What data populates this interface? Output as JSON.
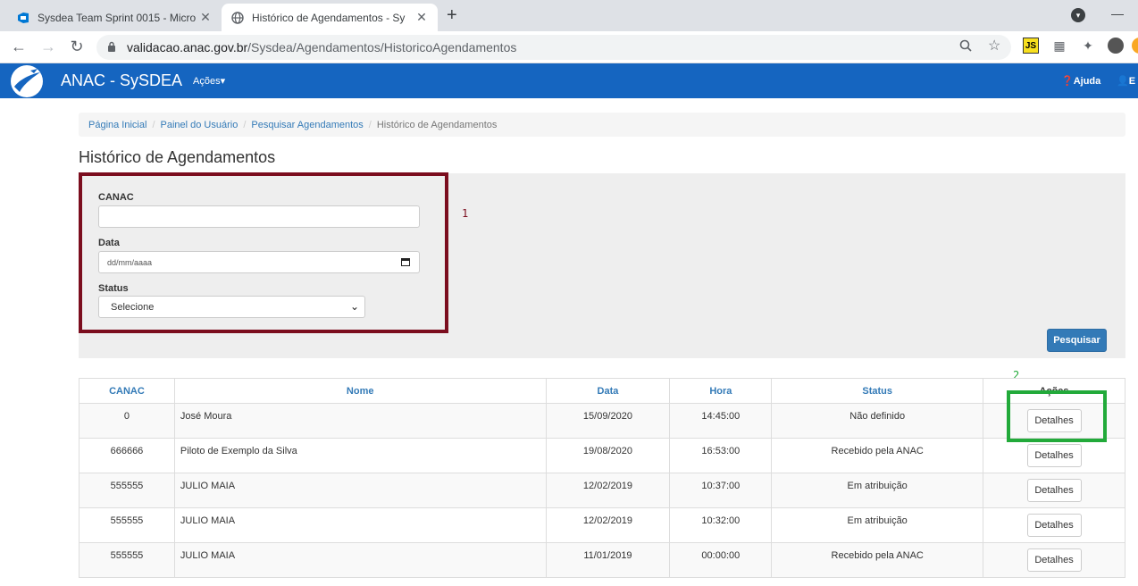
{
  "browser": {
    "tabs": [
      {
        "title": "Sysdea Team Sprint 0015 - Micro",
        "icon": "azure-devops-icon"
      },
      {
        "title": "Histórico de Agendamentos - Sy",
        "icon": "globe-icon"
      }
    ],
    "close_glyph": "✕",
    "new_tab_glyph": "+",
    "url_host": "validacao.anac.gov.br",
    "url_path": "/Sysdea/Agendamentos/HistoricoAgendamentos",
    "extensions": [
      "JS",
      "▦",
      "✦"
    ]
  },
  "navbar": {
    "brand": "ANAC - SySDEA",
    "menu_acoes": "Ações",
    "ajuda": "Ajuda",
    "user": "E",
    "accent": "#1565c0"
  },
  "breadcrumb": [
    "Página Inicial",
    "Painel do Usuário",
    "Pesquisar Agendamentos",
    "Histórico de Agendamentos"
  ],
  "page_title": "Histórico de Agendamentos",
  "filter": {
    "canac_label": "CANAC",
    "canac_value": "",
    "data_label": "Data",
    "data_placeholder": "dd/mm/aaaa",
    "status_label": "Status",
    "status_selected": "Selecione",
    "search_button": "Pesquisar"
  },
  "annotations": {
    "one": "1",
    "two": "2",
    "red": "#7b0d1e",
    "green": "#22aa3a"
  },
  "table": {
    "headers": {
      "canac": "CANAC",
      "nome": "Nome",
      "data": "Data",
      "hora": "Hora",
      "status": "Status",
      "acoes": "Ações"
    },
    "action_label": "Detalhes",
    "rows": [
      {
        "canac": "0",
        "nome": "José Moura",
        "data": "15/09/2020",
        "hora": "14:45:00",
        "status": "Não definido"
      },
      {
        "canac": "666666",
        "nome": "Piloto de Exemplo da Silva",
        "data": "19/08/2020",
        "hora": "16:53:00",
        "status": "Recebido pela ANAC"
      },
      {
        "canac": "555555",
        "nome": "JULIO MAIA",
        "data": "12/02/2019",
        "hora": "10:37:00",
        "status": "Em atribuição"
      },
      {
        "canac": "555555",
        "nome": "JULIO MAIA",
        "data": "12/02/2019",
        "hora": "10:32:00",
        "status": "Em atribuição"
      },
      {
        "canac": "555555",
        "nome": "JULIO MAIA",
        "data": "11/01/2019",
        "hora": "00:00:00",
        "status": "Recebido pela ANAC"
      }
    ]
  }
}
